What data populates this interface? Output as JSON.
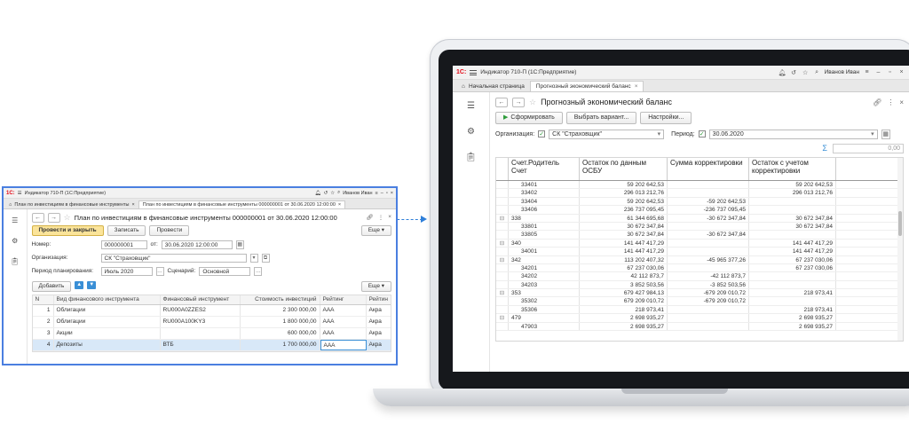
{
  "big": {
    "app_title": "Индикатор 710-П  (1С:Предприятие)",
    "user": "Иванов Иван",
    "tabs": [
      {
        "label": "Начальная страница"
      },
      {
        "label": "Прогнозный экономический баланс"
      }
    ],
    "doc_title": "Прогнозный экономический баланс",
    "buttons": {
      "generate": "Сформировать",
      "variant": "Выбрать вариант...",
      "settings": "Настройки..."
    },
    "org_label": "Организация:",
    "org_value": "СК \"Страховщик\"",
    "period_label": "Период:",
    "period_value": "30.06.2020",
    "sum_value": "0,00",
    "report_headers": {
      "c1a": "Счет.Родитель",
      "c1b": "Счет",
      "c2": "Остаток по данным ОСБУ",
      "c3": "Сумма корректировки",
      "c4": "Остаток с учетом корректировки"
    },
    "rows": [
      {
        "m": "",
        "acc": "33401",
        "a": "59 202 642,53",
        "b": "",
        "c": "59 202 642,53"
      },
      {
        "m": "",
        "acc": "33402",
        "a": "296 013 212,76",
        "b": "",
        "c": "296 013 212,76"
      },
      {
        "m": "",
        "acc": "33404",
        "a": "59 202 642,53",
        "b": "-59 202 642,53",
        "c": ""
      },
      {
        "m": "",
        "acc": "33406",
        "a": "236 737 095,45",
        "b": "-236 737 095,45",
        "c": ""
      },
      {
        "m": "⊟",
        "acc": "338",
        "a": "61 344 695,68",
        "b": "-30 672 347,84",
        "c": "30 672 347,84"
      },
      {
        "m": "",
        "acc": "33801",
        "a": "30 672 347,84",
        "b": "",
        "c": "30 672 347,84"
      },
      {
        "m": "",
        "acc": "33805",
        "a": "30 672 347,84",
        "b": "-30 672 347,84",
        "c": ""
      },
      {
        "m": "⊟",
        "acc": "340",
        "a": "141 447 417,29",
        "b": "",
        "c": "141 447 417,29"
      },
      {
        "m": "",
        "acc": "34001",
        "a": "141 447 417,29",
        "b": "",
        "c": "141 447 417,29"
      },
      {
        "m": "⊟",
        "acc": "342",
        "a": "113 202 407,32",
        "b": "-45 965 377,26",
        "c": "67 237 030,06"
      },
      {
        "m": "",
        "acc": "34201",
        "a": "67 237 030,06",
        "b": "",
        "c": "67 237 030,06"
      },
      {
        "m": "",
        "acc": "34202",
        "a": "42 112 873,7",
        "b": "-42 112 873,7",
        "c": ""
      },
      {
        "m": "",
        "acc": "34203",
        "a": "3 852 503,56",
        "b": "-3 852 503,56",
        "c": ""
      },
      {
        "m": "⊟",
        "acc": "353",
        "a": "679 427 984,13",
        "b": "-679 209 010,72",
        "c": "218 973,41"
      },
      {
        "m": "",
        "acc": "35302",
        "a": "679 209 010,72",
        "b": "-679 209 010,72",
        "c": ""
      },
      {
        "m": "",
        "acc": "35306",
        "a": "218 973,41",
        "b": "",
        "c": "218 973,41"
      },
      {
        "m": "⊟",
        "acc": "479",
        "a": "2 698 935,27",
        "b": "",
        "c": "2 698 935,27"
      },
      {
        "m": "",
        "acc": "47903",
        "a": "2 698 935,27",
        "b": "",
        "c": "2 698 935,27"
      }
    ]
  },
  "small": {
    "app_title": "Индикатор 710-П  (1С:Предприятие)",
    "user": "Иванов Иван",
    "tabs": [
      {
        "label": "План по инвестициям в финансовые инструменты"
      },
      {
        "label": "План по инвестициям в финансовые инструменты 000000001 от 30.06.2020 12:00:00"
      }
    ],
    "doc_title": "План по инвестициям в финансовые инструменты 000000001 от 30.06.2020 12:00:00",
    "buttons": {
      "post_close": "Провести и закрыть",
      "write": "Записать",
      "post": "Провести",
      "more": "Еще ▾",
      "add": "Добавить",
      "more2": "Еще ▾"
    },
    "number_label": "Номер:",
    "number_value": "000000001",
    "from_label": "от:",
    "date_value": "30.06.2020 12:00:00",
    "org_label": "Организация:",
    "org_value": "СК \"Страховщик\"",
    "period_label": "Период планирования:",
    "period_value": "Июль 2020",
    "scenario_label": "Сценарий:",
    "scenario_value": "Основной",
    "table_headers": [
      "N",
      "Вид финансового инструмента",
      "Финансовый инструмент",
      "Стоимость инвестиций",
      "Рейтинг",
      "Рейтин"
    ],
    "rows": [
      {
        "n": "1",
        "kind": "Облигации",
        "inst": "RU000A0ZZES2",
        "cost": "2 300 000,00",
        "rating": "AAA",
        "r2": "Акра"
      },
      {
        "n": "2",
        "kind": "Облигации",
        "inst": "RU000A100KY3",
        "cost": "1 800 000,00",
        "rating": "AAA",
        "r2": "Акра"
      },
      {
        "n": "3",
        "kind": "Акции",
        "inst": "",
        "cost": "600 000,00",
        "rating": "AAA",
        "r2": "Акра"
      },
      {
        "n": "4",
        "kind": "Депозиты",
        "inst": "ВТБ",
        "cost": "1 700 000,00",
        "rating": "AAA",
        "r2": "Акра"
      }
    ]
  }
}
